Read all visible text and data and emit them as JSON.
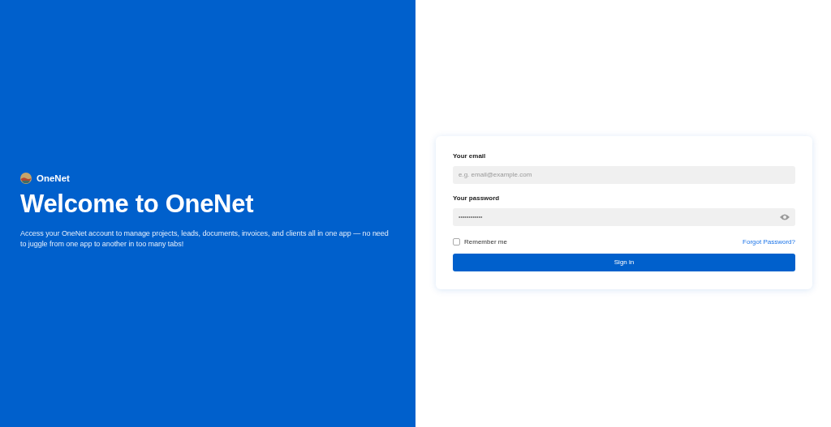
{
  "brand": {
    "name": "OneNet"
  },
  "hero": {
    "title": "Welcome to OneNet",
    "description": "Access your OneNet account to manage projects, leads, documents, invoices, and clients all in one app — no need to juggle from one app to another in too many tabs!"
  },
  "login_form": {
    "email": {
      "label": "Your email",
      "placeholder": "e.g. email@example.com"
    },
    "password": {
      "label": "Your password",
      "value": "••••••••••••"
    },
    "remember_me": {
      "label": "Remember me",
      "checked": false
    },
    "forgot_link": "Forgot Password?",
    "submit": "Sign in"
  }
}
